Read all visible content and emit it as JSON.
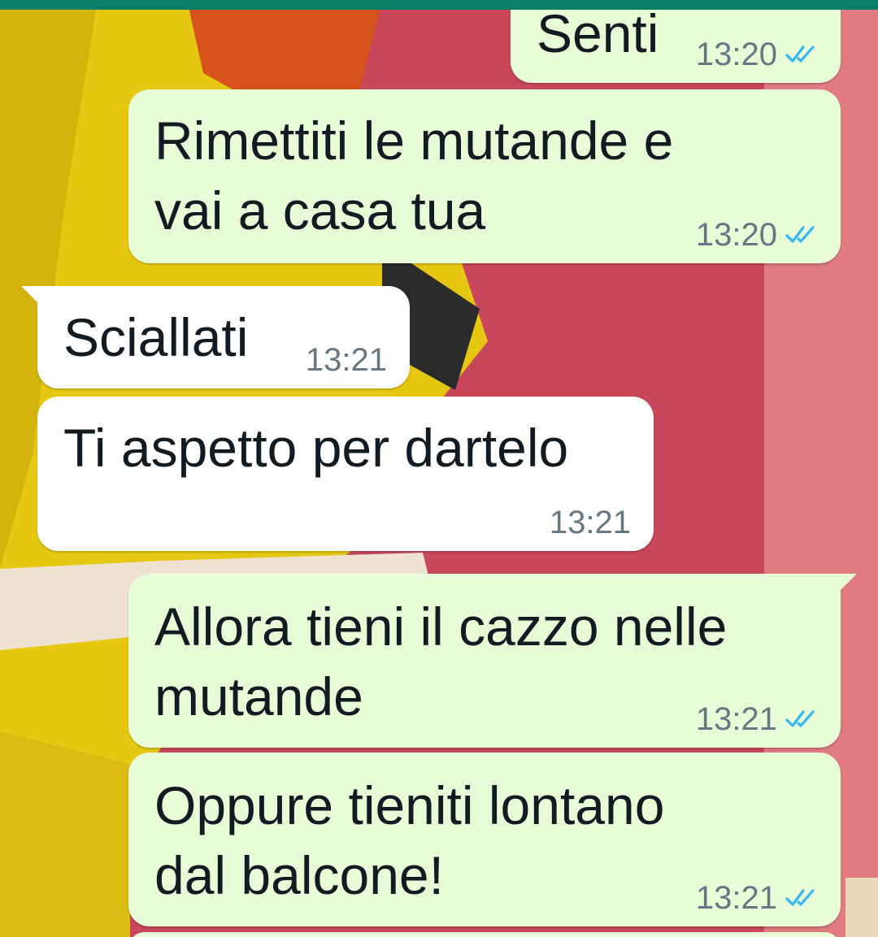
{
  "colors": {
    "header": "#0b7e66",
    "outgoing_bubble": "#e7fcd7",
    "incoming_bubble": "#ffffff",
    "read_ticks": "#34b7f1",
    "timestamp": "#667781",
    "text": "#111b21"
  },
  "messages": [
    {
      "direction": "outgoing",
      "text": "Senti",
      "time": "13:20",
      "status": "read",
      "status_icon": "double-check-icon"
    },
    {
      "direction": "outgoing",
      "text": "Rimettiti le mutande e\nvai a casa tua",
      "time": "13:20",
      "status": "read",
      "status_icon": "double-check-icon"
    },
    {
      "direction": "incoming",
      "text": "Sciallati",
      "time": "13:21"
    },
    {
      "direction": "incoming",
      "text": "Ti aspetto per dartelo",
      "time": "13:21"
    },
    {
      "direction": "outgoing",
      "text": "Allora tieni il cazzo nelle\nmutande",
      "time": "13:21",
      "status": "read",
      "status_icon": "double-check-icon"
    },
    {
      "direction": "outgoing",
      "text": "Oppure tieniti lontano\ndal balcone!",
      "time": "13:21",
      "status": "read",
      "status_icon": "double-check-icon"
    }
  ]
}
